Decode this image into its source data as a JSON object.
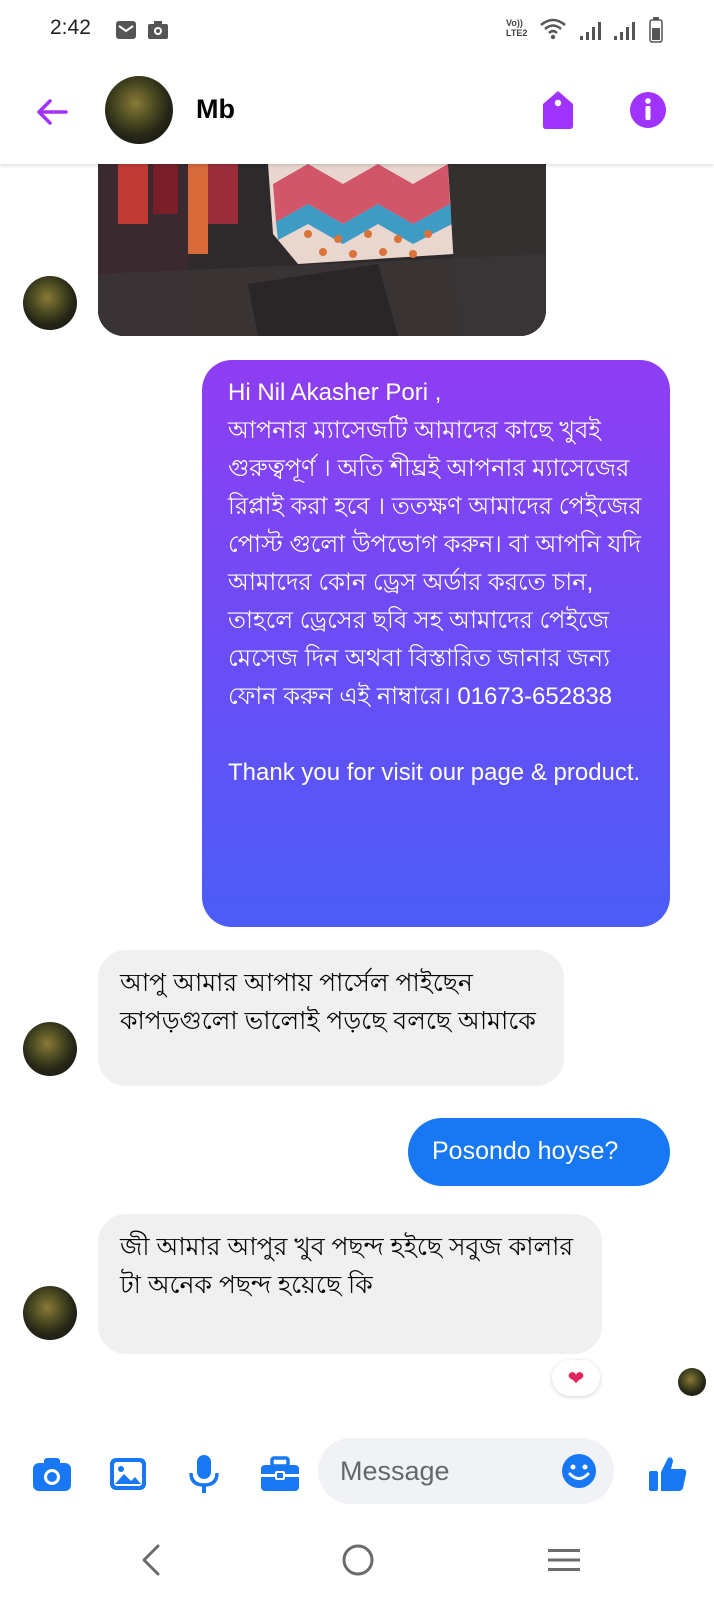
{
  "status_bar": {
    "time": "2:42",
    "network_label": "Vo)) LTE2"
  },
  "header": {
    "contact_name": "Mb"
  },
  "messages": {
    "out_long": "Hi Nil Akasher Pori ,\nআপনার ম্যাসেজটি আমাদের কাছে খুবই গুরুত্বপূর্ণ । অতি শীঘ্রই আপনার ম্যাসেজের রিপ্লাই করা হবে । ততক্ষণ আমাদের পেইজের পোস্ট গুলো উপভোগ করুন। বা আপনি যদি আমাদের কোন ড্রেস অর্ডার করতে চান, তাহলে ড্রেসের ছবি সহ আমাদের পেইজে মেসেজ দিন অথবা বিস্তারিত জানার জন্য ফোন করুন এই নাম্বারে। 01673-652838\n\nThank you for visit our page & product.",
    "in_1": "আপু আমার আপায় পার্সেল পাইছেন কাপড়গুলো ভালোই পড়ছে  বলছে আমাকে",
    "out_short": "Posondo hoyse?",
    "in_2": "জী আমার আপুর  খুব পছন্দ হইছে সবুজ কালার টা অনেক পছন্দ হয়েছে কি",
    "reaction": "❤"
  },
  "composer": {
    "placeholder": "Message"
  },
  "colors": {
    "accent": "#a033ff",
    "messenger_blue": "#1877f2",
    "incoming_bubble": "#f0f0f0"
  },
  "icons": [
    "back-arrow-icon",
    "tag-icon",
    "info-icon",
    "camera-icon",
    "gallery-icon",
    "microphone-icon",
    "briefcase-icon",
    "emoji-icon",
    "like-icon",
    "nav-back-icon",
    "nav-home-icon",
    "nav-menu-icon"
  ]
}
